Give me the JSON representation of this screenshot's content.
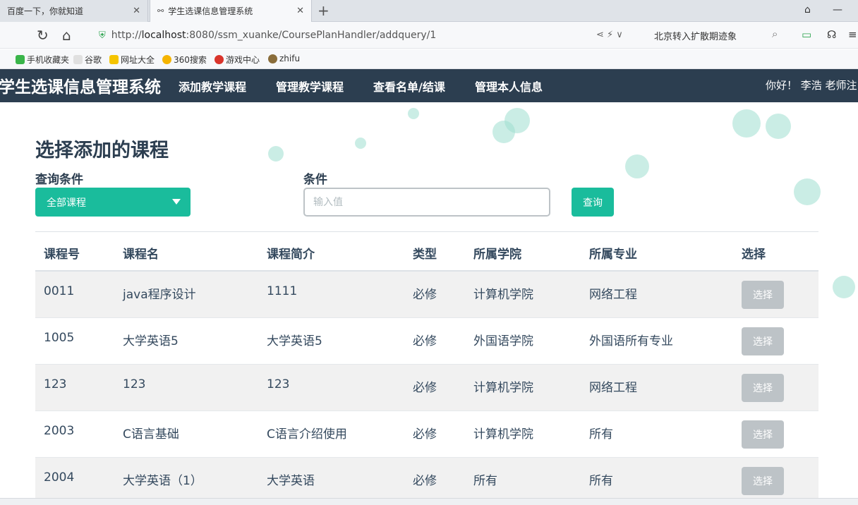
{
  "browser": {
    "tabs": [
      {
        "title": "百度一下，你就知道",
        "active": false
      },
      {
        "title": "学生选课信息管理系统",
        "active": true
      }
    ],
    "url_scheme": "http://",
    "url_host": "localhost",
    "url_path": ":8080/ssm_xuanke/CoursePlanHandler/addquery/1",
    "search_hint": "北京转入扩散期迹象",
    "bookmarks": [
      "手机收藏夹",
      "谷歌",
      "网址大全",
      "360搜索",
      "游戏中心",
      "zhifu"
    ]
  },
  "app": {
    "brand": "学生选课信息管理系统",
    "nav": [
      "添加教学课程",
      "管理教学课程",
      "查看名单/结课",
      "管理本人信息"
    ],
    "user_greeting": "你好！ 李浩 老师注"
  },
  "page": {
    "title": "选择添加的课程",
    "filter_label": "查询条件",
    "filter_value": "全部课程",
    "condition_label": "条件",
    "condition_placeholder": "输入值",
    "query_button": "查询"
  },
  "table": {
    "headers": [
      "课程号",
      "课程名",
      "课程简介",
      "类型",
      "所属学院",
      "所属专业",
      "选择"
    ],
    "action_label": "选择",
    "rows": [
      [
        "0011",
        "java程序设计",
        "1111",
        "必修",
        "计算机学院",
        "网络工程"
      ],
      [
        "1005",
        "大学英语5",
        "大学英语5",
        "必修",
        "外国语学院",
        "外国语所有专业"
      ],
      [
        "123",
        "123",
        "123",
        "必修",
        "计算机学院",
        "网络工程"
      ],
      [
        "2003",
        "C语言基础",
        "C语言介绍使用",
        "必修",
        "计算机学院",
        "所有"
      ],
      [
        "2004",
        "大学英语（1）",
        "大学英语",
        "必修",
        "所有",
        "所有"
      ]
    ]
  },
  "colors": {
    "navbar": "#2c3e50",
    "accent": "#1abc9c",
    "disabled_button": "#bdc3c7"
  }
}
